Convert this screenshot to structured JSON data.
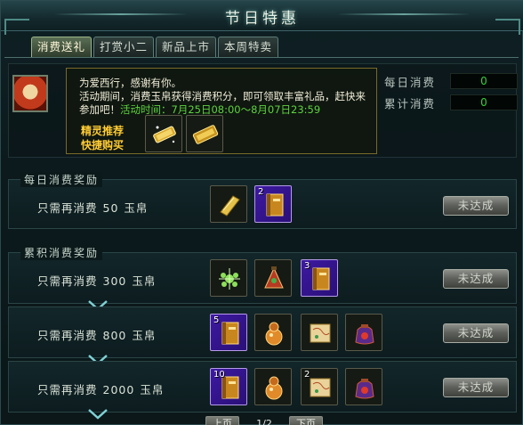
{
  "window": {
    "title": "节日特惠"
  },
  "tabs": [
    {
      "label": "消费送礼",
      "active": true
    },
    {
      "label": "打赏小二",
      "active": false
    },
    {
      "label": "新品上市",
      "active": false
    },
    {
      "label": "本周特卖",
      "active": false
    }
  ],
  "notice": {
    "line1": "为爱西行，感谢有你。",
    "line2": "活动期间，消费玉帛获得消费积分，即可领取丰富礼品，赶快来参加吧！",
    "time_label": "活动时间：",
    "time_value": "7月25日08:00～8月07日23:59",
    "recommend_line1": "精灵推荐",
    "recommend_line2": "快捷购买"
  },
  "stats": {
    "daily_label": "每日消费",
    "daily_value": "0",
    "total_label": "累计消费",
    "total_value": "0"
  },
  "daily_section": {
    "title": "每日消费奖励",
    "rows": [
      {
        "prefix": "只需再消费",
        "amount": "50",
        "unit": "玉帛",
        "button": "未达成"
      }
    ]
  },
  "total_section": {
    "title": "累积消费奖励",
    "rows": [
      {
        "prefix": "只需再消费",
        "amount": "300",
        "unit": "玉帛",
        "button": "未达成"
      },
      {
        "prefix": "只需再消费",
        "amount": "800",
        "unit": "玉帛",
        "button": "未达成"
      },
      {
        "prefix": "只需再消费",
        "amount": "2000",
        "unit": "玉帛",
        "button": "未达成"
      }
    ]
  },
  "item_counts": {
    "daily_book": "2",
    "r1_book": "3",
    "r2_book": "5",
    "r3_book": "10",
    "r3_scroll": "2"
  },
  "pager": {
    "prev": "上页",
    "page": "1/2",
    "next": "下页"
  },
  "colors": {
    "accent_green": "#36d23a",
    "gold": "#ffcc33",
    "purple_slot": "#3d1aa0"
  }
}
